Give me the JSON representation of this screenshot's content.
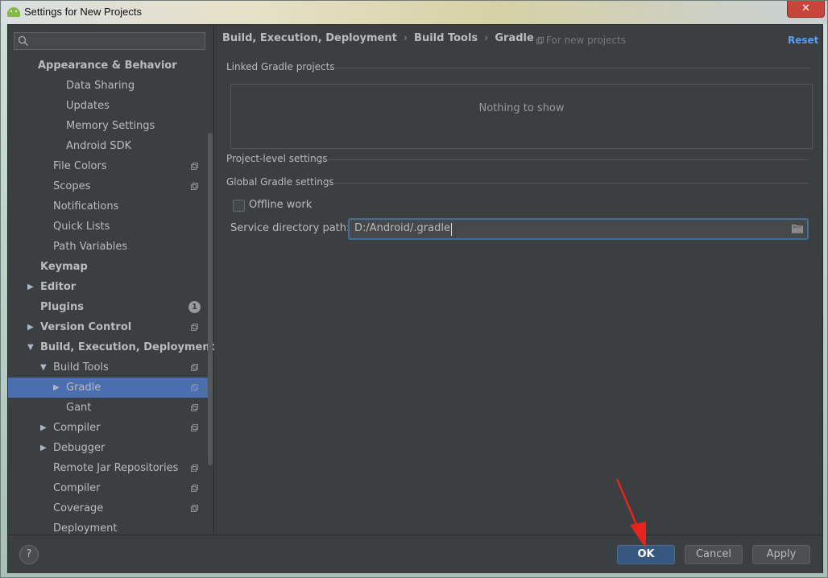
{
  "window": {
    "title": "Settings for New Projects",
    "close_glyph": "✕"
  },
  "sidebar": {
    "search_placeholder": "",
    "items": [
      {
        "label": "Appearance & Behavior",
        "bold": true,
        "indent": 37,
        "arrow": "",
        "proj": false
      },
      {
        "label": "Data Sharing",
        "bold": false,
        "indent": 72,
        "arrow": "",
        "proj": false
      },
      {
        "label": "Updates",
        "bold": false,
        "indent": 72,
        "arrow": "",
        "proj": false
      },
      {
        "label": "Memory Settings",
        "bold": false,
        "indent": 72,
        "arrow": "",
        "proj": false
      },
      {
        "label": "Android SDK",
        "bold": false,
        "indent": 72,
        "arrow": "",
        "proj": false
      },
      {
        "label": "File Colors",
        "bold": false,
        "indent": 56,
        "arrow": "",
        "proj": true
      },
      {
        "label": "Scopes",
        "bold": false,
        "indent": 56,
        "arrow": "",
        "proj": true
      },
      {
        "label": "Notifications",
        "bold": false,
        "indent": 56,
        "arrow": "",
        "proj": false
      },
      {
        "label": "Quick Lists",
        "bold": false,
        "indent": 56,
        "arrow": "",
        "proj": false
      },
      {
        "label": "Path Variables",
        "bold": false,
        "indent": 56,
        "arrow": "",
        "proj": false
      },
      {
        "label": "Keymap",
        "bold": true,
        "indent": 40,
        "arrow": "",
        "proj": false
      },
      {
        "label": "Editor",
        "bold": true,
        "indent": 40,
        "arrow": "▶",
        "proj": false
      },
      {
        "label": "Plugins",
        "bold": true,
        "indent": 40,
        "arrow": "",
        "proj": false,
        "badge": "1"
      },
      {
        "label": "Version Control",
        "bold": true,
        "indent": 40,
        "arrow": "▶",
        "proj": true
      },
      {
        "label": "Build, Execution, Deployment",
        "bold": true,
        "indent": 40,
        "arrow": "▼",
        "proj": false
      },
      {
        "label": "Build Tools",
        "bold": false,
        "indent": 56,
        "arrow": "▼",
        "proj": true
      },
      {
        "label": "Gradle",
        "bold": false,
        "indent": 72,
        "arrow": "▶",
        "proj": true,
        "selected": true
      },
      {
        "label": "Gant",
        "bold": false,
        "indent": 72,
        "arrow": "",
        "proj": true
      },
      {
        "label": "Compiler",
        "bold": false,
        "indent": 56,
        "arrow": "▶",
        "proj": true
      },
      {
        "label": "Debugger",
        "bold": false,
        "indent": 56,
        "arrow": "▶",
        "proj": false
      },
      {
        "label": "Remote Jar Repositories",
        "bold": false,
        "indent": 56,
        "arrow": "",
        "proj": true
      },
      {
        "label": "Compiler",
        "bold": false,
        "indent": 56,
        "arrow": "",
        "proj": true
      },
      {
        "label": "Coverage",
        "bold": false,
        "indent": 56,
        "arrow": "",
        "proj": true
      },
      {
        "label": "Deployment",
        "bold": false,
        "indent": 56,
        "arrow": "",
        "proj": false
      }
    ]
  },
  "content": {
    "breadcrumb": [
      "Build, Execution, Deployment",
      "Build Tools",
      "Gradle"
    ],
    "breadcrumb_sep": "›",
    "for_new_projects": "For new projects",
    "reset_label": "Reset",
    "linked_projects_title": "Linked Gradle projects",
    "empty_text": "Nothing to show",
    "project_level_title": "Project-level settings",
    "global_title": "Global Gradle settings",
    "offline_work_label": "Offline work",
    "offline_work_checked": false,
    "service_dir_label": "Service directory path:",
    "service_dir_value": "D:/Android/.gradle"
  },
  "footer": {
    "help_label": "?",
    "ok_label": "OK",
    "cancel_label": "Cancel",
    "apply_label": "Apply"
  },
  "colors": {
    "selection": "#4b6eaf",
    "link": "#589df6",
    "primary_button": "#365880",
    "annotation_arrow": "#e8231b"
  }
}
